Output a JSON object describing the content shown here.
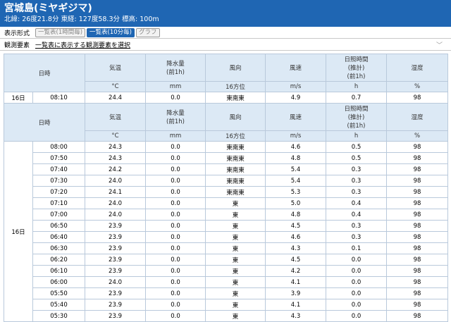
{
  "header": {
    "station_name": "宮城島(ミヤギジマ)",
    "coords": "北緯: 26度21.8分 東経: 127度58.3分 標高: 100m"
  },
  "display_format": {
    "label": "表示形式",
    "buttons": [
      "一覧表(1時間毎)",
      "一覧表(10分毎)",
      "グラフ"
    ],
    "active_index": 1
  },
  "elements": {
    "label": "観測要素",
    "select_text": "一覧表に表示する観測要素を選択"
  },
  "table": {
    "headers": [
      "日時",
      "気温",
      "降水量\n(前1h)",
      "風向",
      "風速",
      "日照時間\n(推計)\n(前1h)",
      "湿度"
    ],
    "units": [
      "°C",
      "mm",
      "16方位",
      "m/s",
      "h",
      "%"
    ],
    "latest": {
      "day": "16日",
      "time": "08:10",
      "temp": "24.4",
      "precip": "0.0",
      "wdir": "東南東",
      "wspeed": "4.9",
      "sun": "0.7",
      "hum": "98"
    },
    "day": "16日",
    "rows": [
      {
        "time": "08:00",
        "temp": "24.3",
        "precip": "0.0",
        "wdir": "東南東",
        "wspeed": "4.6",
        "sun": "0.5",
        "hum": "98"
      },
      {
        "time": "07:50",
        "temp": "24.3",
        "precip": "0.0",
        "wdir": "東南東",
        "wspeed": "4.8",
        "sun": "0.5",
        "hum": "98"
      },
      {
        "time": "07:40",
        "temp": "24.2",
        "precip": "0.0",
        "wdir": "東南東",
        "wspeed": "5.4",
        "sun": "0.3",
        "hum": "98"
      },
      {
        "time": "07:30",
        "temp": "24.0",
        "precip": "0.0",
        "wdir": "東南東",
        "wspeed": "5.4",
        "sun": "0.3",
        "hum": "98"
      },
      {
        "time": "07:20",
        "temp": "24.1",
        "precip": "0.0",
        "wdir": "東南東",
        "wspeed": "5.3",
        "sun": "0.3",
        "hum": "98"
      },
      {
        "time": "07:10",
        "temp": "24.0",
        "precip": "0.0",
        "wdir": "東",
        "wspeed": "5.0",
        "sun": "0.4",
        "hum": "98"
      },
      {
        "time": "07:00",
        "temp": "24.0",
        "precip": "0.0",
        "wdir": "東",
        "wspeed": "4.8",
        "sun": "0.4",
        "hum": "98"
      },
      {
        "time": "06:50",
        "temp": "23.9",
        "precip": "0.0",
        "wdir": "東",
        "wspeed": "4.5",
        "sun": "0.3",
        "hum": "98"
      },
      {
        "time": "06:40",
        "temp": "23.9",
        "precip": "0.0",
        "wdir": "東",
        "wspeed": "4.6",
        "sun": "0.3",
        "hum": "98"
      },
      {
        "time": "06:30",
        "temp": "23.9",
        "precip": "0.0",
        "wdir": "東",
        "wspeed": "4.3",
        "sun": "0.1",
        "hum": "98"
      },
      {
        "time": "06:20",
        "temp": "23.9",
        "precip": "0.0",
        "wdir": "東",
        "wspeed": "4.5",
        "sun": "0.0",
        "hum": "98"
      },
      {
        "time": "06:10",
        "temp": "23.9",
        "precip": "0.0",
        "wdir": "東",
        "wspeed": "4.2",
        "sun": "0.0",
        "hum": "98"
      },
      {
        "time": "06:00",
        "temp": "24.0",
        "precip": "0.0",
        "wdir": "東",
        "wspeed": "4.1",
        "sun": "0.0",
        "hum": "98"
      },
      {
        "time": "05:50",
        "temp": "23.9",
        "precip": "0.0",
        "wdir": "東",
        "wspeed": "3.9",
        "sun": "0.0",
        "hum": "98"
      },
      {
        "time": "05:40",
        "temp": "23.9",
        "precip": "0.0",
        "wdir": "東",
        "wspeed": "4.1",
        "sun": "0.0",
        "hum": "98"
      },
      {
        "time": "05:30",
        "temp": "23.9",
        "precip": "0.0",
        "wdir": "東",
        "wspeed": "4.3",
        "sun": "0.0",
        "hum": "98"
      }
    ]
  }
}
